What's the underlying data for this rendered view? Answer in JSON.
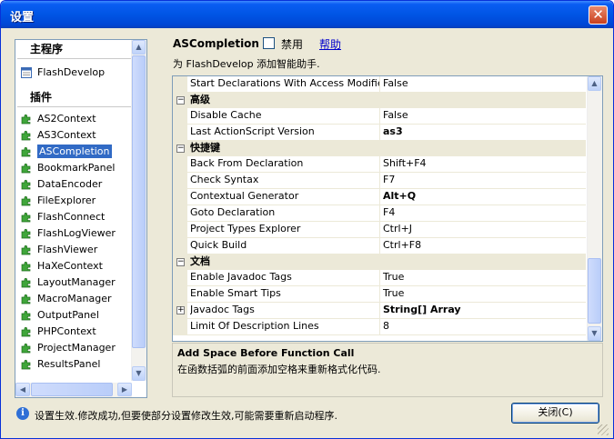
{
  "window": {
    "title": "设置",
    "close_glyph": "✕"
  },
  "tree": {
    "group_main": "主程序",
    "main_items": [
      {
        "label": "FlashDevelop",
        "icon": "window-icon"
      }
    ],
    "group_plugins": "插件",
    "plugins": [
      {
        "label": "AS2Context"
      },
      {
        "label": "AS3Context"
      },
      {
        "label": "ASCompletion",
        "selected": true
      },
      {
        "label": "BookmarkPanel"
      },
      {
        "label": "DataEncoder"
      },
      {
        "label": "FileExplorer"
      },
      {
        "label": "FlashConnect"
      },
      {
        "label": "FlashLogViewer"
      },
      {
        "label": "FlashViewer"
      },
      {
        "label": "HaXeContext"
      },
      {
        "label": "LayoutManager"
      },
      {
        "label": "MacroManager"
      },
      {
        "label": "OutputPanel"
      },
      {
        "label": "PHPContext"
      },
      {
        "label": "ProjectManager"
      },
      {
        "label": "ResultsPanel"
      }
    ]
  },
  "plugin": {
    "name": "ASCompletion",
    "disable_label": "禁用",
    "help_label": "帮助",
    "description": "为 FlashDevelop 添加智能助手."
  },
  "grid": {
    "first_row": {
      "name": "Start Declarations With Access Modifiers",
      "value": "False"
    },
    "categories": [
      {
        "name": "高级",
        "rows": [
          {
            "name": "Disable Cache",
            "value": "False"
          },
          {
            "name": "Last ActionScript Version",
            "value": "as3",
            "bold": true
          }
        ]
      },
      {
        "name": "快捷键",
        "rows": [
          {
            "name": "Back From Declaration",
            "value": "Shift+F4"
          },
          {
            "name": "Check Syntax",
            "value": "F7"
          },
          {
            "name": "Contextual Generator",
            "value": "Alt+Q",
            "bold": true
          },
          {
            "name": "Goto Declaration",
            "value": "F4"
          },
          {
            "name": "Project Types Explorer",
            "value": "Ctrl+J"
          },
          {
            "name": "Quick Build",
            "value": "Ctrl+F8"
          }
        ]
      },
      {
        "name": "文档",
        "rows": [
          {
            "name": "Enable Javadoc Tags",
            "value": "True"
          },
          {
            "name": "Enable Smart Tips",
            "value": "True"
          },
          {
            "name": "Javadoc Tags",
            "value": "String[] Array",
            "bold": true,
            "expandable": true
          },
          {
            "name": "Limit Of Description Lines",
            "value": "8"
          }
        ]
      }
    ]
  },
  "description_box": {
    "title": "Add Space Before Function Call",
    "text": "在函数括弧的前面添加空格来重新格式化代码."
  },
  "status": {
    "text": "设置生效.修改成功,但要使部分设置修改生效,可能需要重新启动程序.",
    "close_button": "关闭(C)"
  },
  "colors": {
    "selection": "#316ac5",
    "titlebar": "#0055e5",
    "close": "#c9401e",
    "link": "#0000cc"
  }
}
